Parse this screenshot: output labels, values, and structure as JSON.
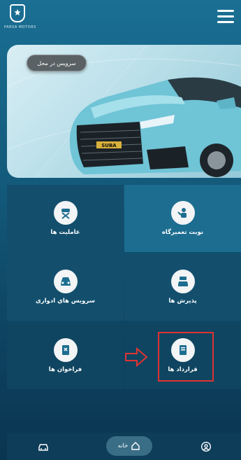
{
  "header": {
    "logo_text": "PARSA MOTORS",
    "menu_icon": "hamburger-menu-icon"
  },
  "hero": {
    "service_button": "سرویس در محل",
    "plate_text": "SUBA"
  },
  "tiles": [
    {
      "label": "نوبت تعمیرگاه",
      "icon": "mechanic-wrench-icon"
    },
    {
      "label": "عاملیت ها",
      "icon": "car-lift-icon"
    },
    {
      "label": "پذیرش ها",
      "icon": "car-service-icon"
    },
    {
      "label": "سرویس هاي ادواری",
      "icon": "car-front-icon"
    },
    {
      "label": "قرارداد ها",
      "icon": "contract-icon"
    },
    {
      "label": "فراخوان ها",
      "icon": "recall-icon"
    }
  ],
  "bottom_nav": {
    "home_label": "خانه",
    "car_icon": "car-icon",
    "home_icon": "home-icon",
    "profile_icon": "user-icon"
  },
  "colors": {
    "accent": "#1c6d90",
    "highlight": "#e03333"
  }
}
